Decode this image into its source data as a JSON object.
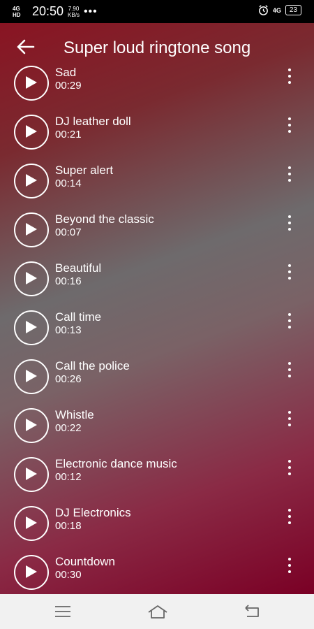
{
  "status": {
    "network": "4G HD",
    "time": "20:50",
    "speed_value": "7.90",
    "speed_unit": "KB/s",
    "dots": "•••",
    "net_right": "4G",
    "battery": "23"
  },
  "header": {
    "title": "Super loud ringtone song"
  },
  "songs": [
    {
      "name": "Sad",
      "duration": "00:29"
    },
    {
      "name": "DJ leather doll",
      "duration": "00:21"
    },
    {
      "name": "Super alert",
      "duration": "00:14"
    },
    {
      "name": "Beyond the classic",
      "duration": "00:07"
    },
    {
      "name": "Beautiful",
      "duration": "00:16"
    },
    {
      "name": "Call time",
      "duration": "00:13"
    },
    {
      "name": "Call the police",
      "duration": "00:26"
    },
    {
      "name": "Whistle",
      "duration": "00:22"
    },
    {
      "name": "Electronic dance music",
      "duration": "00:12"
    },
    {
      "name": "DJ Electronics",
      "duration": "00:18"
    },
    {
      "name": "Countdown",
      "duration": "00:30"
    }
  ],
  "icons": {
    "back": "arrow-left-icon",
    "play": "play-icon",
    "more": "more-vertical-icon",
    "nav_menu": "menu-icon",
    "nav_home": "home-icon",
    "nav_back": "return-icon"
  }
}
